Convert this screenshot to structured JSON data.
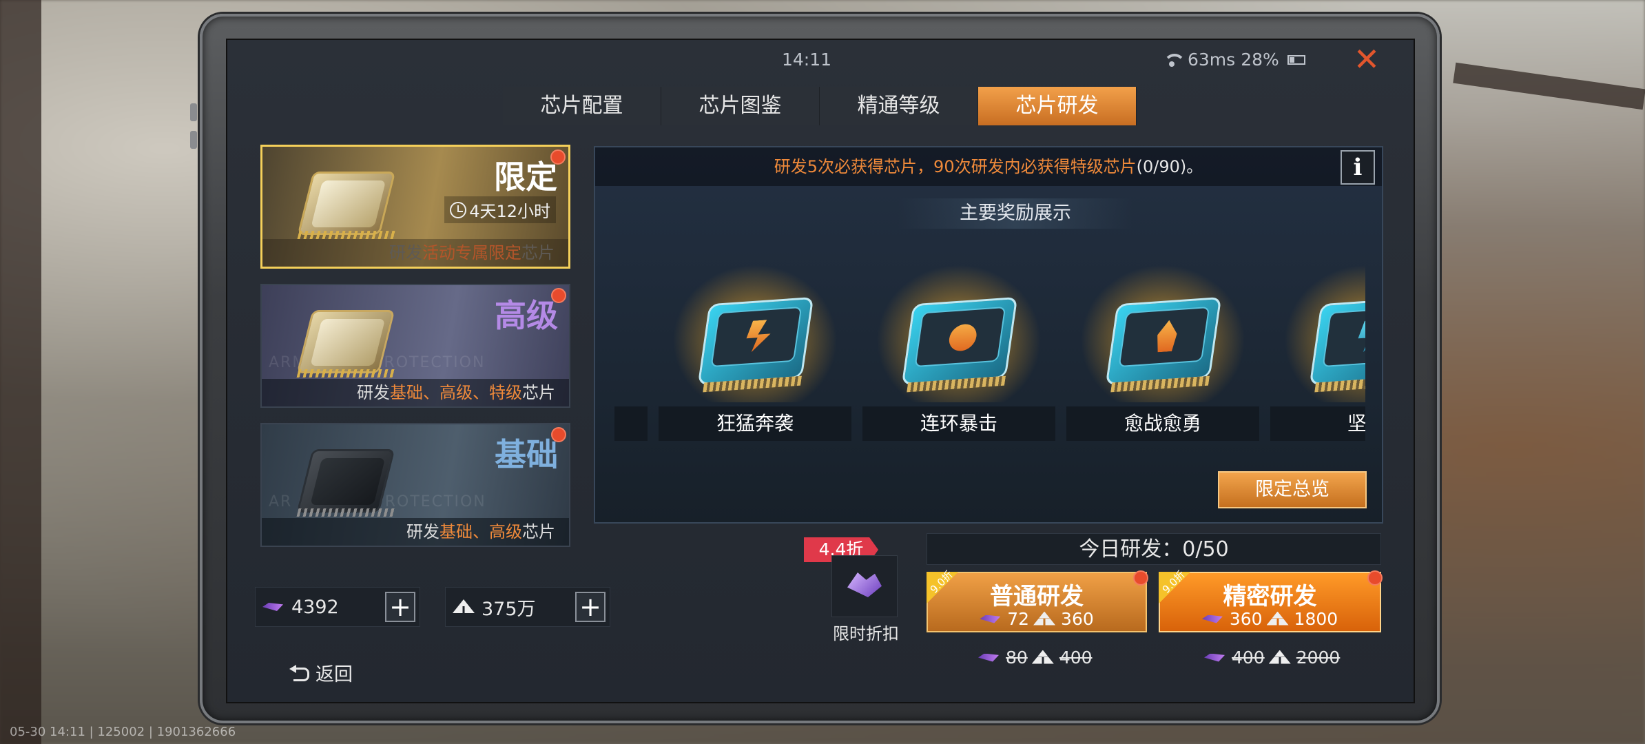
{
  "status": {
    "time": "14:11",
    "ping": "63ms",
    "battery": "28%"
  },
  "tabs": [
    {
      "label": "芯片配置",
      "active": false
    },
    {
      "label": "芯片图鉴",
      "active": false
    },
    {
      "label": "精通等级",
      "active": false
    },
    {
      "label": "芯片研发",
      "active": true
    }
  ],
  "cards": [
    {
      "title": "限定",
      "timer": "4天12小时",
      "desc_prefix": "研发",
      "desc_highlight": "活动专属限定",
      "desc_suffix": "芯片"
    },
    {
      "title": "高级",
      "desc_prefix": "研发",
      "desc_highlight": "基础、高级、特级",
      "desc_suffix": "芯片"
    },
    {
      "title": "基础",
      "desc_prefix": "研发",
      "desc_highlight": "基础、高级",
      "desc_suffix": "芯片"
    }
  ],
  "currency": {
    "gems": "4392",
    "metal": "375万",
    "plus": "+"
  },
  "panel": {
    "notice_prefix": "研发5次必获得芯片，90次研发内必获得",
    "notice_mid": "特级芯片",
    "notice_suffix": "(0/90)。",
    "info": "i",
    "subtitle": "主要奖励展示",
    "rewards": [
      "狂猛奔袭",
      "连环暴击",
      "愈战愈勇",
      "坚如"
    ],
    "overview": "限定总览"
  },
  "discount": {
    "tag": "4.4折",
    "label": "限时折扣"
  },
  "today": "今日研发：0/50",
  "buttons": {
    "normal": {
      "badge": "9.0折",
      "title": "普通研发",
      "gem_cost": "72",
      "metal_cost": "360",
      "orig_gem": "80",
      "orig_metal": "400"
    },
    "precise": {
      "badge": "9.0折",
      "title": "精密研发",
      "gem_cost": "360",
      "metal_cost": "1800",
      "orig_gem": "400",
      "orig_metal": "2000"
    }
  },
  "back": "返回",
  "footer": "05-30 14:11 | 125002 | 1901362666",
  "colors": {
    "accent": "#f08a3a",
    "active_tab": "#e08a36",
    "alert_dot": "#e84b2c",
    "discount_tag": "#e0394a"
  }
}
